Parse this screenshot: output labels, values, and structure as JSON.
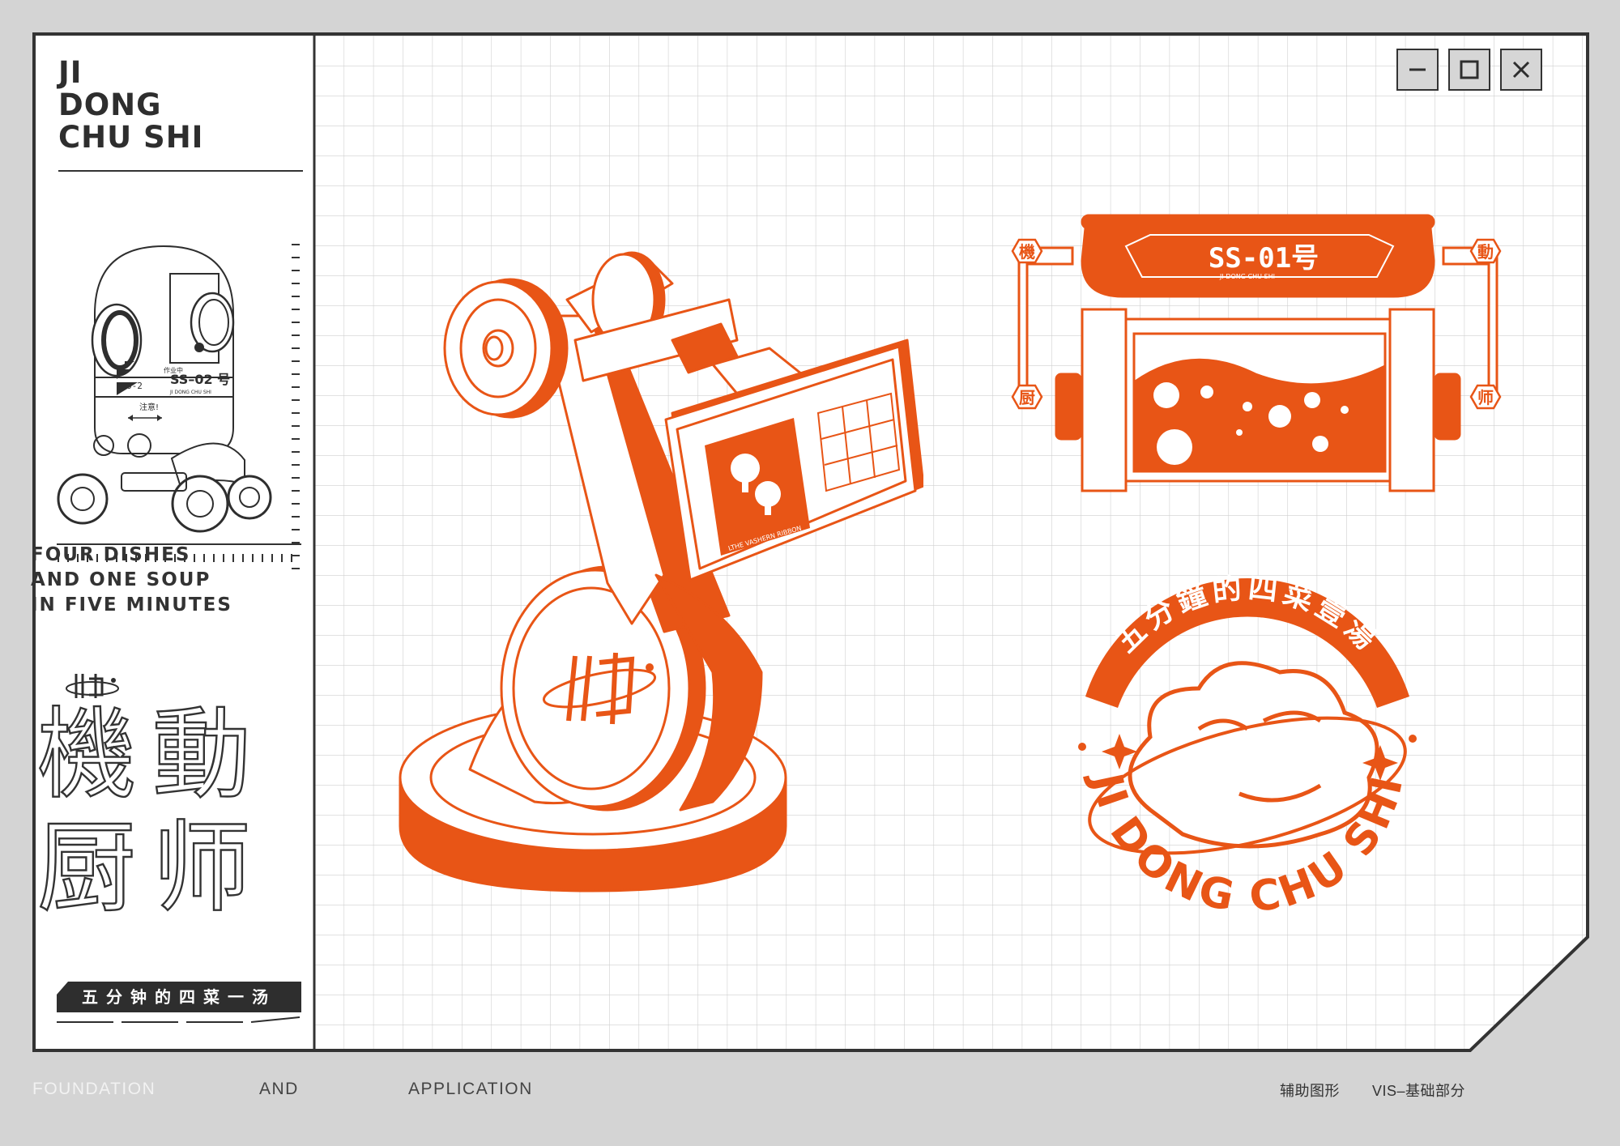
{
  "brand": {
    "name": "JI\nDONG\nCHU SHI"
  },
  "tagline": [
    "FOUR DISHES",
    "AND ONE SOUP",
    "IN FIVE MINUTES"
  ],
  "big_title": [
    "機",
    "動",
    "厨",
    "师"
  ],
  "banner_text": "五分钟的四菜一汤",
  "robot": {
    "model": "SS–02 号",
    "tag": "作业中",
    "unit": "O-2",
    "warning": "注意!",
    "sub": "JI DONG CHU SHI"
  },
  "capsule": {
    "model": "SS-01号",
    "sub": "JI DONG CHU SHI",
    "side_chars": [
      "機",
      "厨",
      "動",
      "师"
    ]
  },
  "arm": {
    "panel_caption": "LTHE VASHERN RIBBON"
  },
  "emblem": {
    "arc_cn": "五分鐘的四菜壹湯",
    "arc_en": "JI DONG CHU SHI"
  },
  "window_controls": [
    "minimize",
    "maximize",
    "close"
  ],
  "footer": {
    "left": "FOUNDATION",
    "middle": "AND",
    "right": "APPLICATION",
    "cn_left": "辅助图形",
    "cn_right": "VIS–基础部分"
  },
  "colors": {
    "accent": "#e85516",
    "ink": "#333333",
    "page": "#d4d4d4",
    "panel": "#ffffff",
    "grid": "#cfcfcf"
  }
}
